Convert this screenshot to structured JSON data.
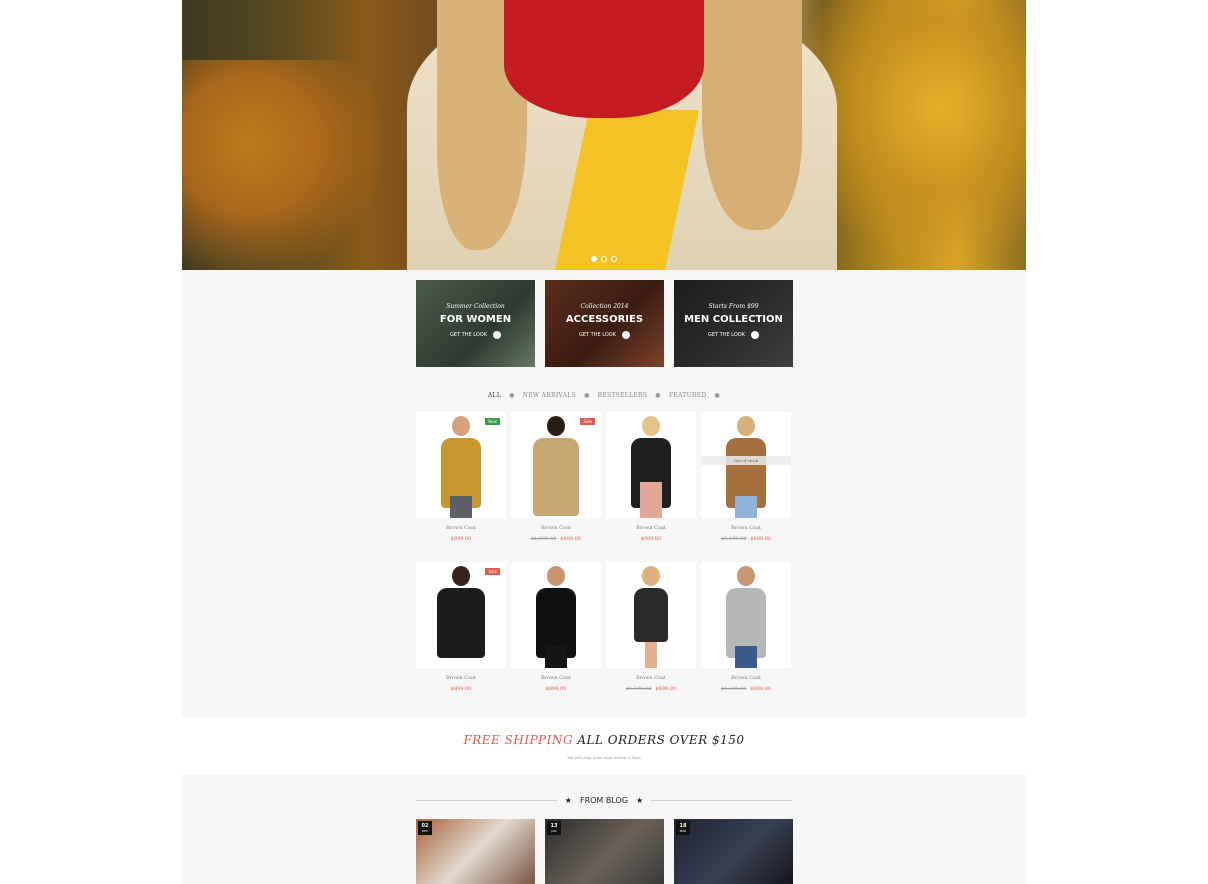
{
  "hero": {
    "slides": 3,
    "active_slide": 1
  },
  "banners": [
    {
      "subtitle": "Summer Collection",
      "title": "FOR WOMEN",
      "cta": "GET THE LOOK"
    },
    {
      "subtitle": "Collection 2014",
      "title": "ACCESSORIES",
      "cta": "GET THE LOOK"
    },
    {
      "subtitle": "Starts From $99",
      "title": "MEN COLLECTION",
      "cta": "GET THE LOOK"
    }
  ],
  "filters": [
    "ALL",
    "NEW ARRIVALS",
    "BESTSELLERS",
    "FEATURED"
  ],
  "products": [
    {
      "name": "Brown Coat",
      "price": "$899.00",
      "old_price": "",
      "badge": "New"
    },
    {
      "name": "Brown Coat",
      "price": "$899.00",
      "old_price": "$1,199.00",
      "badge": "Sale"
    },
    {
      "name": "Brown Coat",
      "price": "$899.00",
      "old_price": "",
      "badge": ""
    },
    {
      "name": "Brown Coat",
      "price": "$899.00",
      "old_price": "$1,199.00",
      "badge": "",
      "overlay": "Out of stock"
    },
    {
      "name": "Brown Coat",
      "price": "$899.00",
      "old_price": "",
      "badge": "Sale"
    },
    {
      "name": "Brown Coat",
      "price": "$899.00",
      "old_price": "",
      "badge": ""
    },
    {
      "name": "Brown Coat",
      "price": "$899.00",
      "old_price": "$1,199.00",
      "badge": ""
    },
    {
      "name": "Brown Coat",
      "price": "$899.00",
      "old_price": "$1,199.00",
      "badge": ""
    }
  ],
  "shipping": {
    "highlight": "FREE SHIPPING",
    "rest": " ALL ORDERS OVER $150",
    "note": "We will ship your item within 3 days"
  },
  "blog": {
    "title": "FROM BLOG",
    "posts": [
      {
        "day": "02",
        "month": "DEC"
      },
      {
        "day": "13",
        "month": "JAN"
      },
      {
        "day": "18",
        "month": "MAR"
      }
    ]
  }
}
